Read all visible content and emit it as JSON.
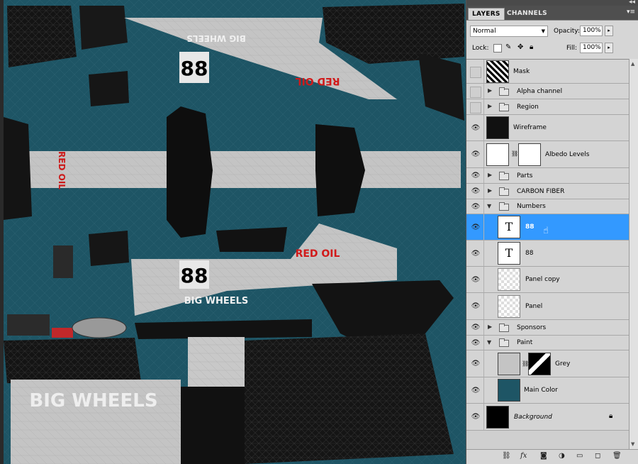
{
  "panel": {
    "tabs": [
      "LAYERS",
      "CHANNELS"
    ],
    "blend_mode": "Normal",
    "opacity_label": "Opacity:",
    "opacity_value": "100%",
    "lock_label": "Lock:",
    "fill_label": "Fill:",
    "fill_value": "100%"
  },
  "layers": [
    {
      "name": "Mask",
      "kind": "image"
    },
    {
      "name": "Alpha channel",
      "kind": "group"
    },
    {
      "name": "Region",
      "kind": "group"
    },
    {
      "name": "Wireframe",
      "kind": "image"
    },
    {
      "name": "Albedo Levels",
      "kind": "adjustment"
    },
    {
      "name": "Parts",
      "kind": "group"
    },
    {
      "name": "CARBON FIBER",
      "kind": "group"
    },
    {
      "name": "Numbers",
      "kind": "group-open"
    },
    {
      "name": "88",
      "kind": "text",
      "selected": true
    },
    {
      "name": "88",
      "kind": "text"
    },
    {
      "name": "Panel copy",
      "kind": "transparent"
    },
    {
      "name": "Panel",
      "kind": "transparent"
    },
    {
      "name": "Sponsors",
      "kind": "group"
    },
    {
      "name": "Paint",
      "kind": "group-open"
    },
    {
      "name": "Grey",
      "kind": "masked"
    },
    {
      "name": "Main Color",
      "kind": "color"
    },
    {
      "name": "Background",
      "kind": "background"
    }
  ],
  "canvas": {
    "number_text": "88",
    "sponsor_text_1": "BIG WHEELS",
    "sponsor_text_2": "RED OIL",
    "paint_color": "#1e5565",
    "stripe_color": "#c4c4c4"
  },
  "icons": {
    "eye": "eye-icon",
    "folder": "folder-icon",
    "lock": "lock-icon"
  }
}
